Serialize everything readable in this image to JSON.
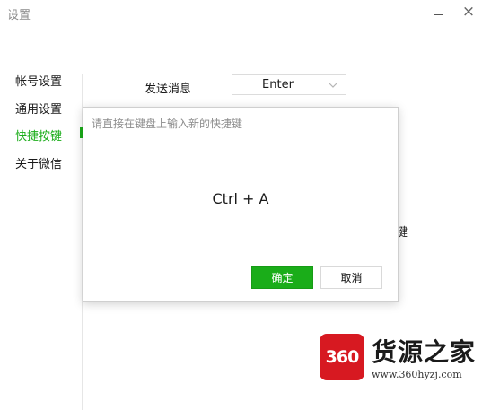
{
  "window": {
    "title": "设置",
    "minimize_label": "—",
    "close_label": "×"
  },
  "sidebar": {
    "items": [
      {
        "label": "帐号设置",
        "active": false
      },
      {
        "label": "通用设置",
        "active": false
      },
      {
        "label": "快捷按键",
        "active": true
      },
      {
        "label": "关于微信",
        "active": false
      }
    ]
  },
  "main": {
    "send_message": {
      "label": "发送消息",
      "selected_value": "Enter"
    },
    "peek_text": "键"
  },
  "dialog": {
    "hint": "请直接在键盘上输入新的快捷键",
    "keys": "Ctrl + A",
    "ok_label": "确定",
    "cancel_label": "取消"
  },
  "watermark": {
    "logo_text": "360",
    "name": "货源之家",
    "url": "www.360hyzj.com"
  },
  "colors": {
    "accent": "#1aad19",
    "watermark_red": "#d71921"
  }
}
